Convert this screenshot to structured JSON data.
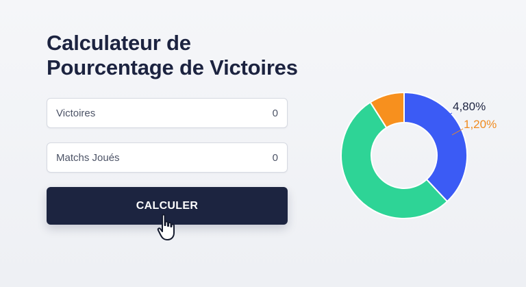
{
  "page": {
    "title_line1": "Calculateur de",
    "title_line2": "Pourcentage de Victoires"
  },
  "form": {
    "wins": {
      "label": "Victoires",
      "value": "0"
    },
    "played": {
      "label": "Matchs Joués",
      "value": "0"
    },
    "submit_label": "CALCULER"
  },
  "chart": {
    "labels": {
      "blue": "4,80%",
      "orange": "1,20%"
    },
    "segments": [
      {
        "color": "#3b5bf5",
        "share": 0.38
      },
      {
        "color": "#2ed496",
        "share": 0.53
      },
      {
        "color": "#f7901e",
        "share": 0.09
      }
    ]
  },
  "colors": {
    "title": "#1c2340",
    "button": "#1c2440",
    "blue": "#3b5bf5",
    "green": "#2ed496",
    "orange": "#f7901e"
  }
}
